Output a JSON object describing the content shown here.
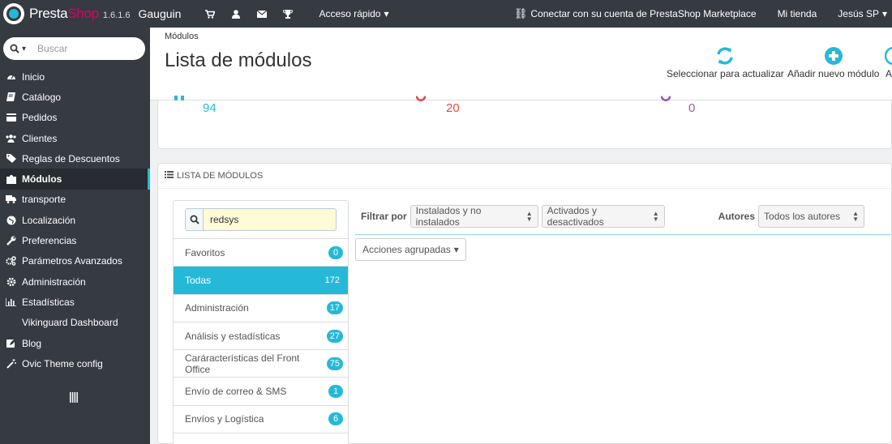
{
  "topbar": {
    "logo_presta": "Presta",
    "logo_shop": "Shop",
    "version": "1.6.1.6",
    "shop_name": "Gauguin",
    "quick_access": "Acceso rápido",
    "marketplace": "Conectar con su cuenta de PrestaShop Marketplace",
    "my_shop": "Mi tienda",
    "user": "Jesús SP"
  },
  "sidebar": {
    "search_placeholder": "Buscar",
    "items": [
      {
        "label": "Inicio",
        "icon": "dashboard-icon"
      },
      {
        "label": "Catálogo",
        "icon": "book-icon"
      },
      {
        "label": "Pedidos",
        "icon": "credit-card-icon"
      },
      {
        "label": "Clientes",
        "icon": "users-icon"
      },
      {
        "label": "Reglas de Descuentos",
        "icon": "tag-icon"
      },
      {
        "label": "Módulos",
        "icon": "puzzle-icon"
      },
      {
        "label": "transporte",
        "icon": "truck-icon"
      },
      {
        "label": "Localización",
        "icon": "globe-icon"
      },
      {
        "label": "Preferencias",
        "icon": "wrench-icon"
      },
      {
        "label": "Parámetros Avanzados",
        "icon": "cogs-icon"
      },
      {
        "label": "Administración",
        "icon": "cog-icon"
      },
      {
        "label": "Estadísticas",
        "icon": "bar-chart-icon"
      },
      {
        "label": "Vikinguard Dashboard",
        "icon": ""
      },
      {
        "label": "Blog",
        "icon": "pencil-square-icon"
      },
      {
        "label": "Ovic Theme config",
        "icon": "magic-icon"
      }
    ]
  },
  "page": {
    "breadcrumb": "Módulos",
    "title": "Lista de módulos",
    "toolbar": {
      "refresh": "Seleccionar para actualizar",
      "add": "Añadir nuevo módulo",
      "third": "A"
    }
  },
  "stats": {
    "a": "94",
    "b": "20",
    "c": "0",
    "colors": {
      "a": "#25b9d7",
      "b": "#e34a4a",
      "c": "#9b59b6"
    }
  },
  "panel": {
    "heading": "LISTA DE MÓDULOS",
    "search_value": "redsys",
    "categories": [
      {
        "label": "Favoritos",
        "count": "0"
      },
      {
        "label": "Todas",
        "count": "172"
      },
      {
        "label": "Administración",
        "count": "17"
      },
      {
        "label": "Análisis y estadísticas",
        "count": "27"
      },
      {
        "label": "Caráracterísticas del Front Office",
        "count": "75"
      },
      {
        "label": "Envío de correo & SMS",
        "count": "1"
      },
      {
        "label": "Envíos y Logística",
        "count": "6"
      },
      {
        "label": "",
        "count": ""
      }
    ],
    "filter_label": "Filtrar por",
    "filter_install": "Instalados y no instalados",
    "filter_active": "Activados y desactivados",
    "authors_label": "Autores",
    "authors_value": "Todos los autores",
    "bulk_actions": "Acciones agrupadas"
  }
}
